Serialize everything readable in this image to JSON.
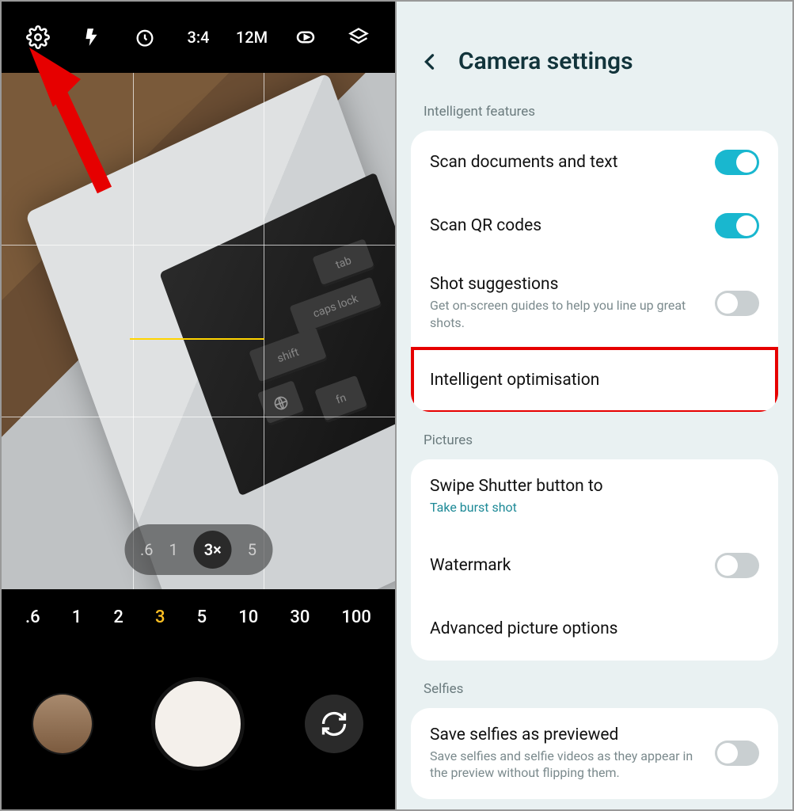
{
  "camera": {
    "toolbar": {
      "ratio": "3:4",
      "resolution": "12M"
    },
    "zoom_ribbon": [
      ".6",
      "1",
      "3×",
      "5"
    ],
    "zoom_ribbon_active": "3×",
    "scale_row": [
      ".6",
      "1",
      "2",
      "3",
      "5",
      "10",
      "30",
      "100"
    ],
    "scale_selected": "3",
    "keys": {
      "tab": "tab",
      "caps": "caps lock",
      "shift": "shift",
      "fn": "fn"
    }
  },
  "settings": {
    "title": "Camera settings",
    "sections": {
      "intelligent": {
        "label": "Intelligent features",
        "scan_docs": {
          "title": "Scan documents and text",
          "on": true
        },
        "scan_qr": {
          "title": "Scan QR codes",
          "on": true
        },
        "shot_sugg": {
          "title": "Shot suggestions",
          "sub": "Get on-screen guides to help you line up great shots.",
          "on": false
        },
        "intel_opt": {
          "title": "Intelligent optimisation"
        }
      },
      "pictures": {
        "label": "Pictures",
        "swipe": {
          "title": "Swipe Shutter button to",
          "sub": "Take burst shot"
        },
        "watermark": {
          "title": "Watermark",
          "on": false
        },
        "advanced": {
          "title": "Advanced picture options"
        }
      },
      "selfies": {
        "label": "Selfies",
        "save_preview": {
          "title": "Save selfies as previewed",
          "sub": "Save selfies and selfie videos as they appear in the preview without flipping them.",
          "on": false
        }
      }
    }
  }
}
